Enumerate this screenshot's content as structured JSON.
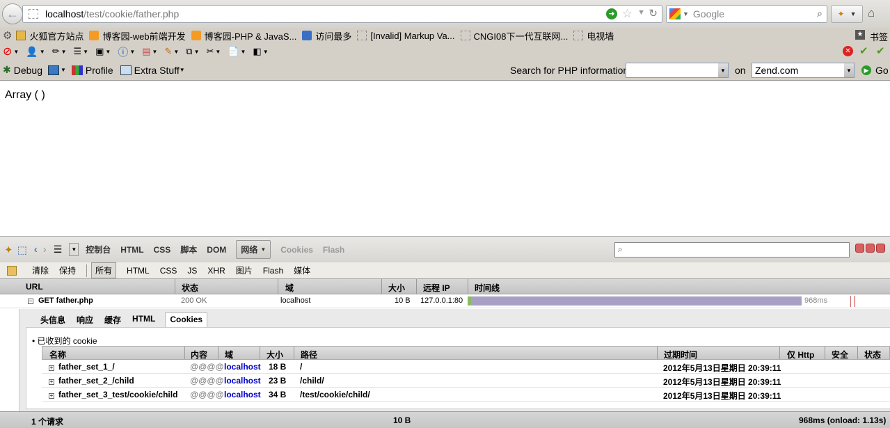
{
  "nav": {
    "url_host": "localhost",
    "url_path": "/test/cookie/father.php",
    "search_placeholder": "Google"
  },
  "bookmarks": {
    "items": [
      {
        "label": "火狐官方站点",
        "icon": "folder-icon"
      },
      {
        "label": "博客园-web前端开发",
        "icon": "rss-icon"
      },
      {
        "label": "博客园-PHP & JavaS...",
        "icon": "rss-icon"
      },
      {
        "label": "访问最多",
        "icon": "magnifier-icon"
      },
      {
        "label": "[Invalid] Markup Va...",
        "icon": "page-icon"
      },
      {
        "label": "CNGI08下一代互联网...",
        "icon": "page-icon"
      },
      {
        "label": "电视墙",
        "icon": "page-icon"
      }
    ],
    "right_label": "书签"
  },
  "firephp": {
    "debug": "Debug",
    "profile": "Profile",
    "extra": "Extra Stuff",
    "search_label": "Search for PHP information:",
    "on_label": "on",
    "site_value": "Zend.com",
    "go_label": "Go"
  },
  "content": {
    "text": "Array ( )"
  },
  "firebug": {
    "tabs": [
      "控制台",
      "HTML",
      "CSS",
      "脚本",
      "DOM"
    ],
    "active_tab": "网络",
    "dim_tabs": [
      "Cookies",
      "Flash"
    ],
    "sub_tabs": [
      "清除",
      "保持",
      "所有",
      "HTML",
      "CSS",
      "JS",
      "XHR",
      "图片",
      "Flash",
      "媒体"
    ],
    "sub_active": "所有",
    "headers": {
      "url": "URL",
      "status": "状态",
      "domain": "域",
      "size": "大小",
      "remote": "远程 IP",
      "timeline": "时间线"
    },
    "request": {
      "method_url": "GET father.php",
      "status": "200 OK",
      "domain": "localhost",
      "size": "10 B",
      "remote": "127.0.0.1:80",
      "time": "968ms"
    },
    "detail_tabs": [
      "头信息",
      "响应",
      "缓存",
      "HTML"
    ],
    "detail_active": "Cookies",
    "received_label": "已收到的 cookie",
    "cookie_headers": {
      "name": "名称",
      "content": "内容",
      "domain": "域",
      "size": "大小",
      "path": "路径",
      "expires": "过期时间",
      "http": "仅 Http",
      "secure": "安全",
      "state": "状态"
    },
    "cookies": [
      {
        "name": "father_set_1_/",
        "content": "@@@@",
        "domain": "localhost",
        "size": "18 B",
        "path": "/",
        "expires": "2012年5月13日星期日 20:39:11"
      },
      {
        "name": "father_set_2_/child",
        "content": "@@@@",
        "domain": "localhost",
        "size": "23 B",
        "path": "/child/",
        "expires": "2012年5月13日星期日 20:39:11"
      },
      {
        "name": "father_set_3_test/cookie/child",
        "content": "@@@@",
        "domain": "localhost",
        "size": "34 B",
        "path": "/test/cookie/child/",
        "expires": "2012年5月13日星期日 20:39:11"
      }
    ],
    "status": {
      "requests": "1 个请求",
      "total_size": "10 B",
      "time": "968ms (onload: 1.13s)"
    }
  }
}
